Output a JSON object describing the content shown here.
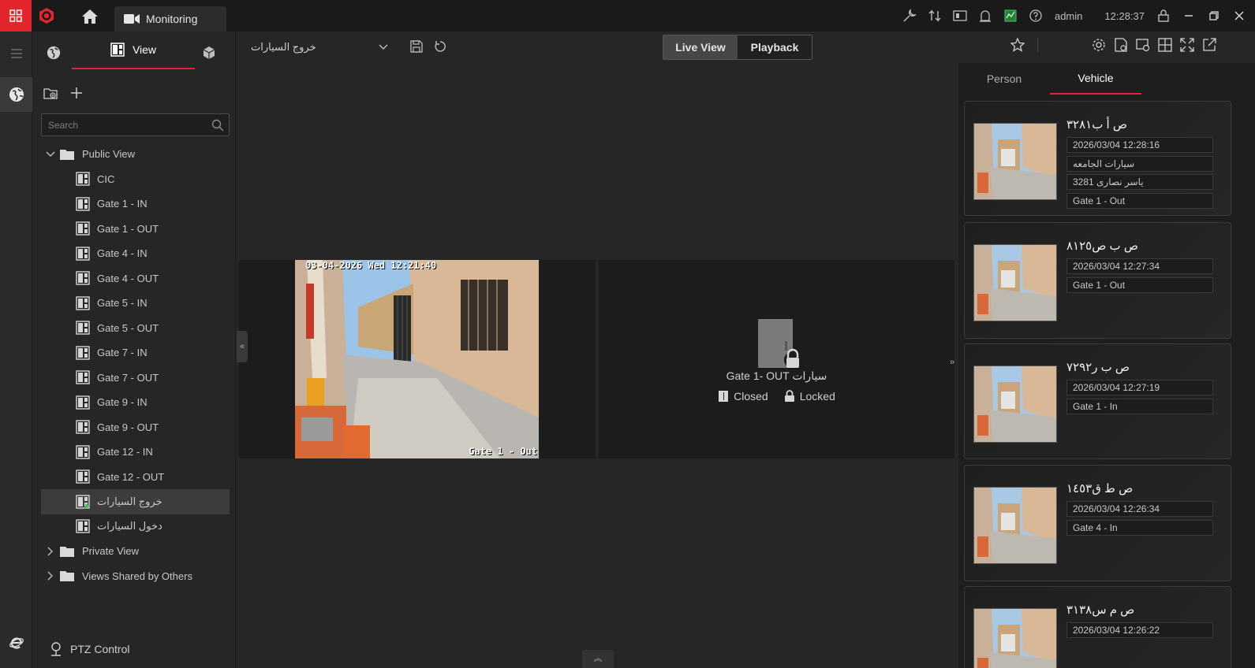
{
  "titlebar": {
    "tab_label": "Monitoring",
    "user": "admin",
    "clock": "12:28:37"
  },
  "left_panel": {
    "tab_view_label": "View",
    "search_placeholder": "Search",
    "public_view": "Public View",
    "views": [
      "CIC",
      "Gate 1 - IN",
      "Gate 1 - OUT",
      "Gate 4 - IN",
      "Gate 4 - OUT",
      "Gate 5 - IN",
      "Gate 5 - OUT",
      "Gate 7 - IN",
      "Gate 7 - OUT",
      "Gate 9 - IN",
      "Gate 9 - OUT",
      "Gate 12 - IN",
      "Gate 12 - OUT",
      "خروج السيارات",
      "دخول السيارات"
    ],
    "selected_view": "خروج السيارات",
    "private_view": "Private View",
    "shared_view": "Views Shared by Others",
    "ptz_label": "PTZ Control"
  },
  "main": {
    "current_view": "خروج السيارات",
    "live_view_label": "Live View",
    "playback_label": "Playback",
    "camera": {
      "osd_time": "03-04-2026 Wed 12:21:40",
      "osd_name": "Gate 1 - Out"
    },
    "door": {
      "title": "Gate 1- OUT سيارات",
      "status_closed": "Closed",
      "status_locked": "Locked"
    }
  },
  "right_panel": {
    "tab_person": "Person",
    "tab_vehicle": "Vehicle",
    "cards": [
      {
        "plate": "ص أ ب٣٢٨١",
        "time": "2026/03/04 12:28:16",
        "group": "سيارات الجامعه",
        "owner": "ياسر نصارى 3281",
        "gate": "Gate 1 - Out"
      },
      {
        "plate": "ص ب ص٨١٢٥",
        "time": "2026/03/04 12:27:34",
        "gate": "Gate 1 - Out"
      },
      {
        "plate": "ص ب ر٧٢٩٢",
        "time": "2026/03/04 12:27:19",
        "gate": "Gate 1 - In"
      },
      {
        "plate": "ص ط ق١٤٥٣",
        "time": "2026/03/04 12:26:34",
        "gate": "Gate 4 - In"
      },
      {
        "plate": "ص م س٣١٣٨",
        "time": "2026/03/04 12:26:22"
      }
    ]
  },
  "colors": {
    "accent": "#e3262e",
    "background": "#262626"
  }
}
